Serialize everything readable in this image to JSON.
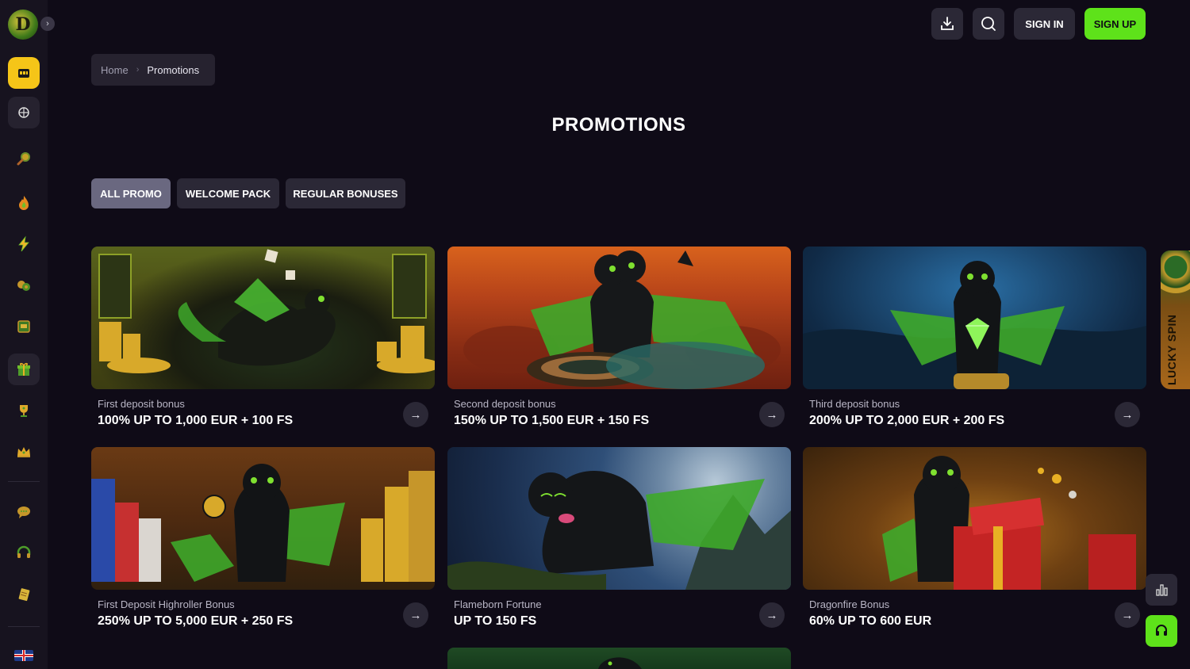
{
  "header": {
    "signin_label": "SIGN IN",
    "signup_label": "SIGN UP",
    "download_icon": "download-icon",
    "search_icon": "search-icon"
  },
  "sidebar": {
    "logo_letter": "D",
    "items": [
      {
        "name": "casino",
        "icon": "slot-machine-icon"
      },
      {
        "name": "sports",
        "icon": "basketball-icon"
      },
      {
        "name": "search",
        "icon": "magnifier-icon"
      },
      {
        "name": "hot",
        "icon": "fire-icon"
      },
      {
        "name": "fast",
        "icon": "lightning-icon"
      },
      {
        "name": "live",
        "icon": "chips-icon"
      },
      {
        "name": "slots",
        "icon": "slot-icon"
      },
      {
        "name": "promotions",
        "icon": "gift-icon"
      },
      {
        "name": "tournaments",
        "icon": "trophy-icon"
      },
      {
        "name": "vip",
        "icon": "crown-icon"
      },
      {
        "name": "chat",
        "icon": "chat-icon"
      },
      {
        "name": "support",
        "icon": "headset-icon"
      },
      {
        "name": "rules",
        "icon": "scroll-icon"
      }
    ]
  },
  "breadcrumb": {
    "home": "Home",
    "current": "Promotions"
  },
  "title": "PROMOTIONS",
  "filters": [
    "ALL PROMO",
    "WELCOME PACK",
    "REGULAR BONUSES"
  ],
  "promos": [
    {
      "subtitle": "First deposit bonus",
      "title": "100% UP TO 1,000 EUR + 100 FS"
    },
    {
      "subtitle": "Second deposit bonus",
      "title": "150% UP TO 1,500 EUR + 150 FS"
    },
    {
      "subtitle": "Third deposit bonus",
      "title": "200% UP TO 2,000 EUR + 200 FS"
    },
    {
      "subtitle": "First Deposit Highroller Bonus",
      "title": "250% UP TO 5,000 EUR + 250 FS"
    },
    {
      "subtitle": "Flameborn Fortune",
      "title": "UP TO 150 FS"
    },
    {
      "subtitle": "Dragonfire Bonus",
      "title": "60% UP TO 600 EUR"
    }
  ],
  "lucky_spin": "LUCKY SPIN",
  "colors": {
    "accent_green": "#5ee21a",
    "accent_yellow": "#f5c518",
    "bg": "#0f0b17"
  }
}
